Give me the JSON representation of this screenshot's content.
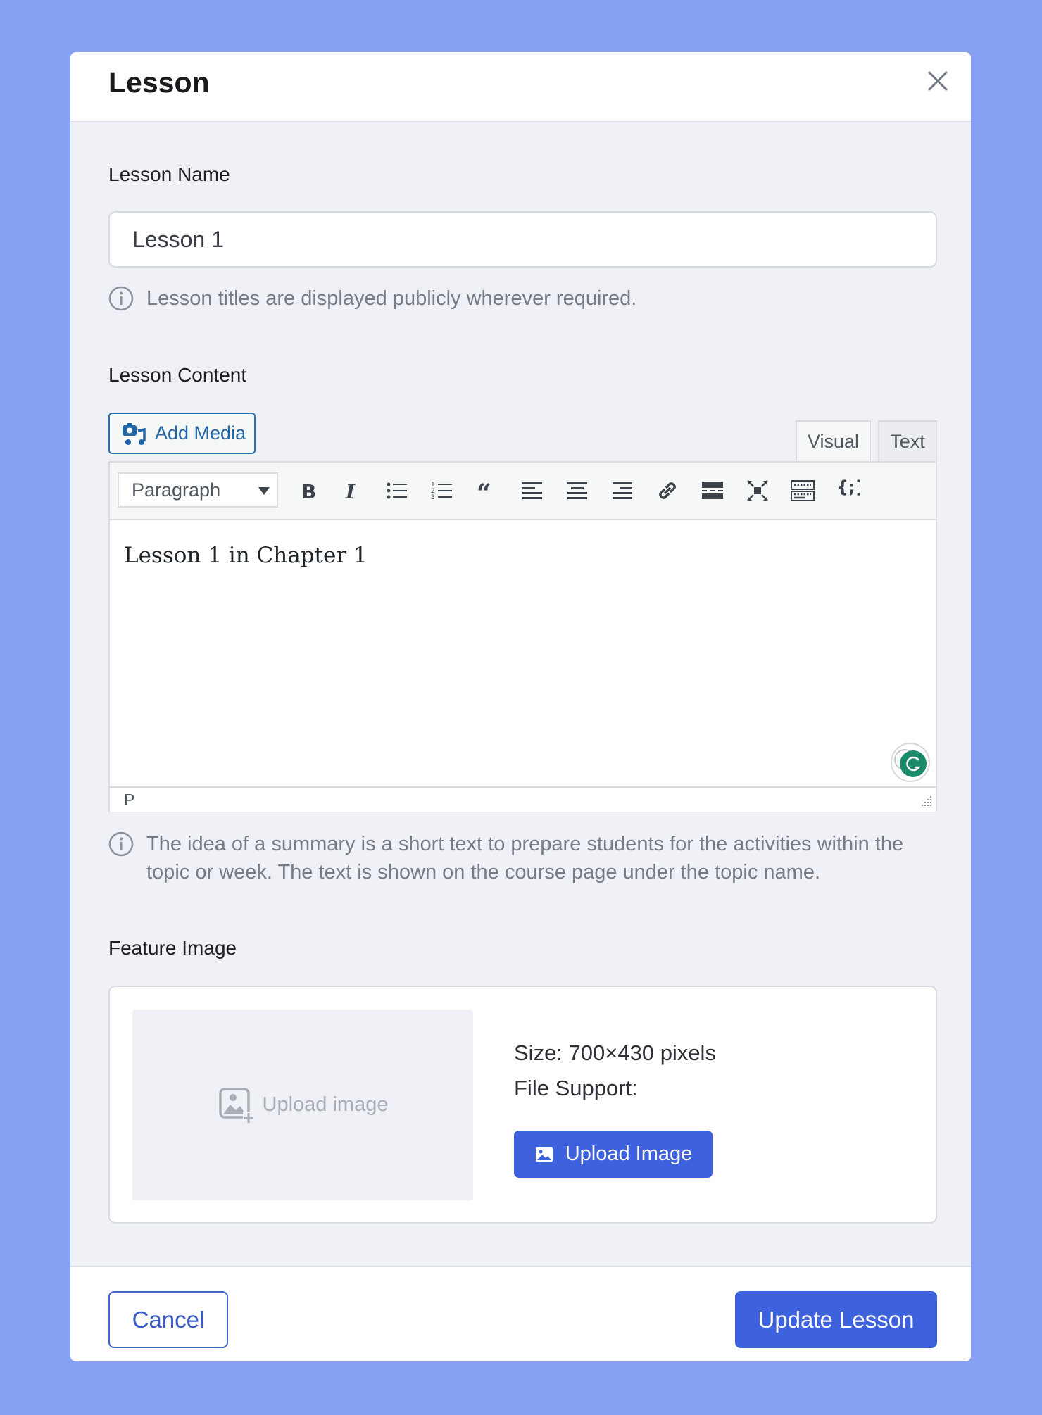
{
  "modal": {
    "title": "Lesson",
    "close_icon": "close-icon"
  },
  "lesson_name": {
    "label": "Lesson Name",
    "value": "Lesson 1",
    "help": "Lesson titles are displayed publicly wherever required."
  },
  "lesson_content": {
    "label": "Lesson Content",
    "add_media_label": "Add Media",
    "tabs": [
      {
        "label": "Visual",
        "active": true
      },
      {
        "label": "Text",
        "active": false
      }
    ],
    "toolbar": {
      "format_selected": "Paragraph",
      "buttons": [
        "bold",
        "italic",
        "bulleted-list",
        "numbered-list",
        "blockquote",
        "align-left",
        "align-center",
        "align-right",
        "insert-link",
        "read-more",
        "fullscreen",
        "toolbar-toggle",
        "shortcode"
      ]
    },
    "content": "Lesson 1 in Chapter 1",
    "status_path": "P",
    "help": "The idea of a summary is a short text to prepare students for the activities within the topic or week. The text is shown on the course page under the topic name."
  },
  "feature_image": {
    "label": "Feature Image",
    "placeholder_label": "Upload image",
    "size_text": "Size: 700×430 pixels",
    "file_support_text": "File Support:",
    "upload_button_label": "Upload Image"
  },
  "footer": {
    "cancel_label": "Cancel",
    "submit_label": "Update Lesson"
  },
  "colors": {
    "backdrop": "#87a1f5",
    "primary": "#3e62dd",
    "wp_link": "#2266a8"
  }
}
